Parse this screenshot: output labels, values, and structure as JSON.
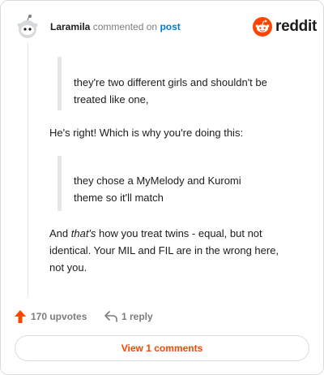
{
  "header": {
    "username": "Laramila",
    "action_text": "commented on",
    "post_link": "post",
    "logo_text": "reddit"
  },
  "comment": {
    "quote1_line1": "they're two different girls and shouldn't be",
    "quote1_line2": "treated like one,",
    "para1": "He's right! Which is why you're doing this:",
    "quote2_line1": "they chose a MyMelody and Kuromi",
    "quote2_line2": "theme so it'll match",
    "para2_line1_before": "And ",
    "para2_line1_emph": "that's",
    "para2_line1_after": " how you treat twins - equal, but not",
    "para2_line2": "identical. Your MIL and FIL are in the wrong here,",
    "para2_line3": "not you."
  },
  "footer": {
    "upvotes_label": "170 upvotes",
    "reply_label": "1 reply",
    "view_comments_label": "View 1 comments"
  },
  "colors": {
    "accent": "#ff4500",
    "link": "#0079d3",
    "muted": "#7c7c7c"
  },
  "icons": [
    "avatar",
    "reddit-logo-icon",
    "upvote-arrow-icon",
    "reply-arrow-icon"
  ]
}
